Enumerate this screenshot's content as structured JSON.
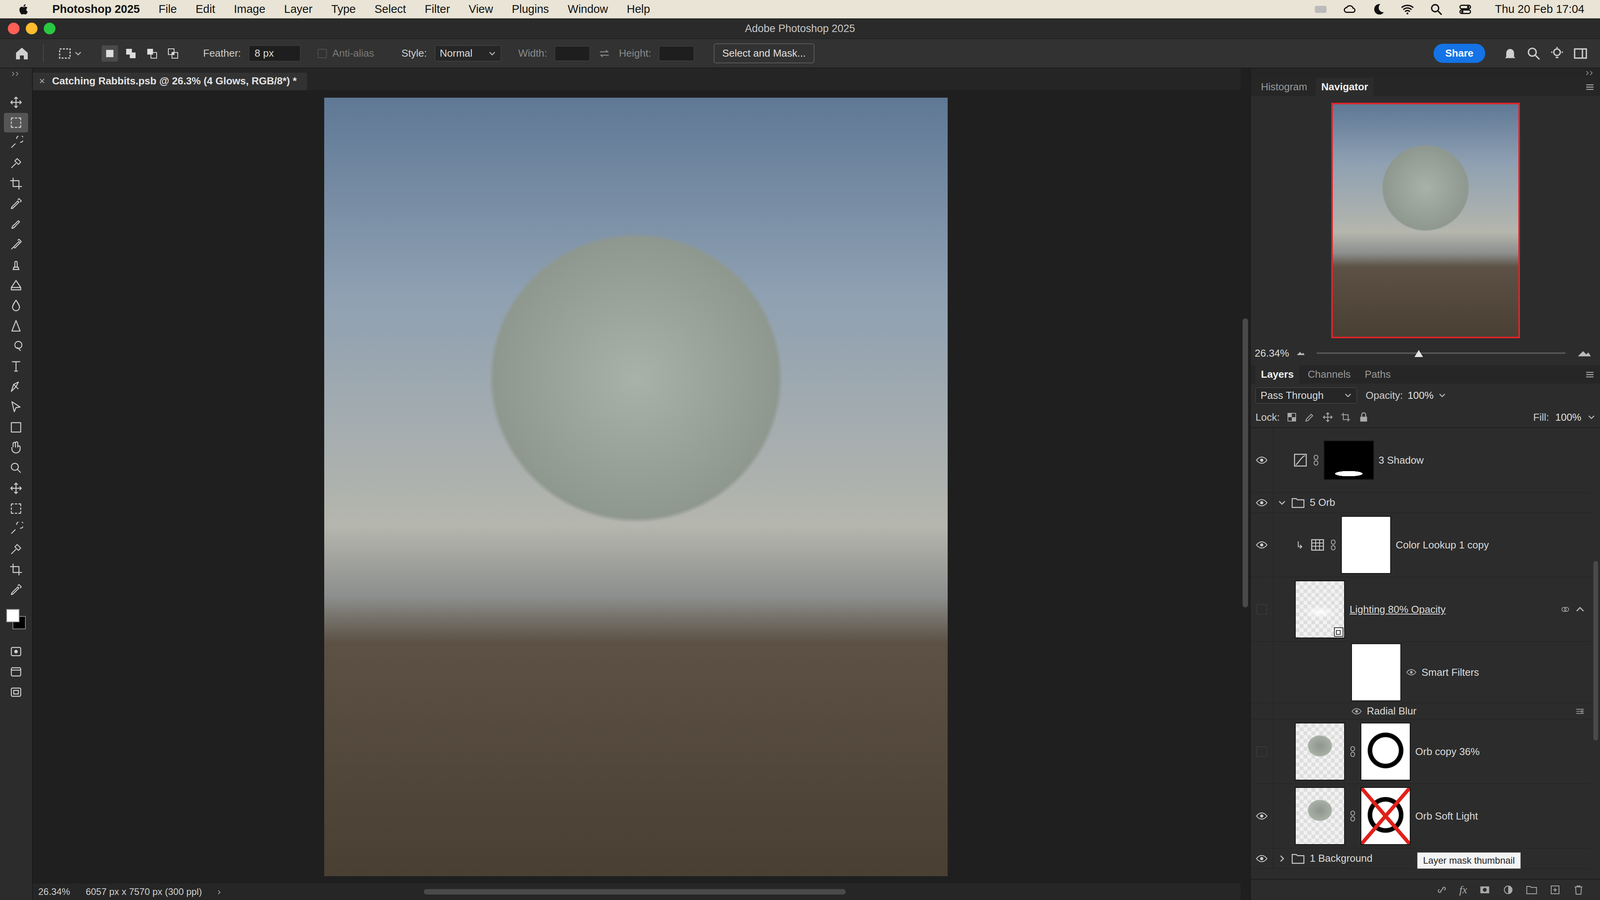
{
  "menubar": {
    "app": "Photoshop 2025",
    "menus": [
      "File",
      "Edit",
      "Image",
      "Layer",
      "Type",
      "Select",
      "Filter",
      "View",
      "Plugins",
      "Window",
      "Help"
    ],
    "clock": "Thu 20 Feb 17:04"
  },
  "window": {
    "title": "Adobe Photoshop 2025"
  },
  "options": {
    "selection_modes": [
      {
        "selected": true
      },
      {
        "selected": false
      },
      {
        "selected": false
      },
      {
        "selected": false
      }
    ],
    "feather_label": "Feather:",
    "feather_value": "8 px",
    "anti_alias": {
      "label": "Anti-alias",
      "checked": false,
      "disabled": true
    },
    "style_label": "Style:",
    "style_value": "Normal",
    "width_label": "Width:",
    "width_value": "",
    "height_label": "Height:",
    "height_value": "",
    "mask_button": "Select and Mask...",
    "share_button": "Share"
  },
  "tools": [
    {
      "selected": false
    },
    {
      "selected": true
    },
    {
      "selected": false
    },
    {
      "selected": false
    },
    {
      "selected": false
    },
    {
      "selected": false
    },
    {
      "selected": false
    },
    {
      "selected": false
    },
    {
      "selected": false
    },
    {
      "selected": false
    },
    {
      "selected": false
    },
    {
      "selected": false
    },
    {
      "selected": false
    },
    {
      "selected": false
    },
    {
      "selected": false
    },
    {
      "selected": false
    },
    {
      "selected": false
    },
    {
      "selected": false
    },
    {
      "selected": false
    },
    {
      "selected": false
    },
    {
      "selected": false
    },
    {
      "selected": false
    },
    {
      "selected": false
    },
    {
      "selected": false
    },
    {
      "selected": false
    }
  ],
  "more_tools": [
    {
      "selected": false
    },
    {
      "selected": false
    },
    {
      "selected": false
    }
  ],
  "document": {
    "tab": "Catching Rabbits.psb @ 26.3% (4 Glows, RGB/8*) *",
    "close": "×",
    "zoom": "26.34%",
    "size": "6057 px x 7570 px (300 ppl)",
    "more": "›"
  },
  "navigator": {
    "tabs": [
      {
        "label": "Histogram",
        "selected": false
      },
      {
        "label": "Navigator",
        "selected": true
      }
    ],
    "zoom": "26.34%",
    "level": 0.41
  },
  "layers_panel": {
    "tabs": [
      {
        "label": "Layers",
        "selected": true
      },
      {
        "label": "Channels",
        "selected": false
      },
      {
        "label": "Paths",
        "selected": false
      }
    ],
    "blend_mode": "Pass Through",
    "opacity_label": "Opacity:",
    "opacity": "100%",
    "lock_label": "Lock:",
    "fill_label": "Fill:",
    "fill": "100%",
    "footer_fx": "fx",
    "tooltip": "Layer mask thumbnail"
  },
  "layers": [
    {
      "name": "3 Shadow",
      "kind": "adjustment",
      "visible": true,
      "in_group": false,
      "clipped": false,
      "mask": "black",
      "mask_disabled": false,
      "underlined": false,
      "expanded": false
    },
    {
      "name": "5 Orb",
      "kind": "group",
      "visible": true,
      "in_group": false,
      "clipped": false,
      "mask": "none",
      "mask_disabled": false,
      "underlined": false,
      "expanded": true
    },
    {
      "name": "Color Lookup 1 copy",
      "kind": "adjustment",
      "visible": true,
      "in_group": true,
      "clipped": true,
      "mask": "white",
      "mask_disabled": false,
      "underlined": false,
      "expanded": false
    },
    {
      "name": "Lighting 80% Opacity",
      "kind": "smart",
      "visible": false,
      "in_group": true,
      "clipped": false,
      "mask": "none",
      "mask_disabled": false,
      "underlined": true,
      "expanded": true
    },
    {
      "name": "Smart Filters",
      "kind": "smart-filters",
      "visible": true,
      "in_group": true,
      "clipped": false,
      "mask": "white",
      "mask_disabled": false,
      "underlined": false,
      "expanded": false
    },
    {
      "name": "Radial Blur",
      "kind": "filter",
      "visible": true,
      "in_group": true,
      "clipped": false,
      "mask": "none",
      "mask_disabled": false,
      "underlined": false,
      "expanded": false
    },
    {
      "name": "Orb copy 36%",
      "kind": "pixel",
      "visible": false,
      "in_group": true,
      "clipped": false,
      "mask": "ring",
      "mask_disabled": false,
      "underlined": false,
      "expanded": false
    },
    {
      "name": "Orb Soft Light",
      "kind": "pixel",
      "visible": true,
      "in_group": true,
      "clipped": false,
      "mask": "ring",
      "mask_disabled": true,
      "underlined": false,
      "expanded": false
    },
    {
      "name": "1 Background",
      "kind": "group",
      "visible": true,
      "in_group": false,
      "clipped": false,
      "mask": "none",
      "mask_disabled": false,
      "underlined": false,
      "expanded": false
    }
  ]
}
